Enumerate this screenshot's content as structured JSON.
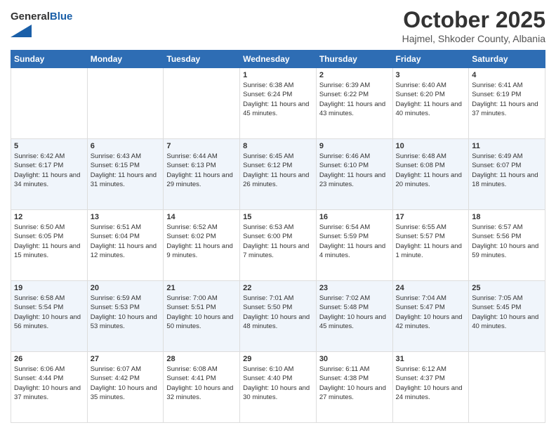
{
  "logo": {
    "general": "General",
    "blue": "Blue"
  },
  "header": {
    "month": "October 2025",
    "location": "Hajmel, Shkoder County, Albania"
  },
  "weekdays": [
    "Sunday",
    "Monday",
    "Tuesday",
    "Wednesday",
    "Thursday",
    "Friday",
    "Saturday"
  ],
  "weeks": [
    [
      {
        "day": "",
        "info": ""
      },
      {
        "day": "",
        "info": ""
      },
      {
        "day": "",
        "info": ""
      },
      {
        "day": "1",
        "info": "Sunrise: 6:38 AM\nSunset: 6:24 PM\nDaylight: 11 hours and 45 minutes."
      },
      {
        "day": "2",
        "info": "Sunrise: 6:39 AM\nSunset: 6:22 PM\nDaylight: 11 hours and 43 minutes."
      },
      {
        "day": "3",
        "info": "Sunrise: 6:40 AM\nSunset: 6:20 PM\nDaylight: 11 hours and 40 minutes."
      },
      {
        "day": "4",
        "info": "Sunrise: 6:41 AM\nSunset: 6:19 PM\nDaylight: 11 hours and 37 minutes."
      }
    ],
    [
      {
        "day": "5",
        "info": "Sunrise: 6:42 AM\nSunset: 6:17 PM\nDaylight: 11 hours and 34 minutes."
      },
      {
        "day": "6",
        "info": "Sunrise: 6:43 AM\nSunset: 6:15 PM\nDaylight: 11 hours and 31 minutes."
      },
      {
        "day": "7",
        "info": "Sunrise: 6:44 AM\nSunset: 6:13 PM\nDaylight: 11 hours and 29 minutes."
      },
      {
        "day": "8",
        "info": "Sunrise: 6:45 AM\nSunset: 6:12 PM\nDaylight: 11 hours and 26 minutes."
      },
      {
        "day": "9",
        "info": "Sunrise: 6:46 AM\nSunset: 6:10 PM\nDaylight: 11 hours and 23 minutes."
      },
      {
        "day": "10",
        "info": "Sunrise: 6:48 AM\nSunset: 6:08 PM\nDaylight: 11 hours and 20 minutes."
      },
      {
        "day": "11",
        "info": "Sunrise: 6:49 AM\nSunset: 6:07 PM\nDaylight: 11 hours and 18 minutes."
      }
    ],
    [
      {
        "day": "12",
        "info": "Sunrise: 6:50 AM\nSunset: 6:05 PM\nDaylight: 11 hours and 15 minutes."
      },
      {
        "day": "13",
        "info": "Sunrise: 6:51 AM\nSunset: 6:04 PM\nDaylight: 11 hours and 12 minutes."
      },
      {
        "day": "14",
        "info": "Sunrise: 6:52 AM\nSunset: 6:02 PM\nDaylight: 11 hours and 9 minutes."
      },
      {
        "day": "15",
        "info": "Sunrise: 6:53 AM\nSunset: 6:00 PM\nDaylight: 11 hours and 7 minutes."
      },
      {
        "day": "16",
        "info": "Sunrise: 6:54 AM\nSunset: 5:59 PM\nDaylight: 11 hours and 4 minutes."
      },
      {
        "day": "17",
        "info": "Sunrise: 6:55 AM\nSunset: 5:57 PM\nDaylight: 11 hours and 1 minute."
      },
      {
        "day": "18",
        "info": "Sunrise: 6:57 AM\nSunset: 5:56 PM\nDaylight: 10 hours and 59 minutes."
      }
    ],
    [
      {
        "day": "19",
        "info": "Sunrise: 6:58 AM\nSunset: 5:54 PM\nDaylight: 10 hours and 56 minutes."
      },
      {
        "day": "20",
        "info": "Sunrise: 6:59 AM\nSunset: 5:53 PM\nDaylight: 10 hours and 53 minutes."
      },
      {
        "day": "21",
        "info": "Sunrise: 7:00 AM\nSunset: 5:51 PM\nDaylight: 10 hours and 50 minutes."
      },
      {
        "day": "22",
        "info": "Sunrise: 7:01 AM\nSunset: 5:50 PM\nDaylight: 10 hours and 48 minutes."
      },
      {
        "day": "23",
        "info": "Sunrise: 7:02 AM\nSunset: 5:48 PM\nDaylight: 10 hours and 45 minutes."
      },
      {
        "day": "24",
        "info": "Sunrise: 7:04 AM\nSunset: 5:47 PM\nDaylight: 10 hours and 42 minutes."
      },
      {
        "day": "25",
        "info": "Sunrise: 7:05 AM\nSunset: 5:45 PM\nDaylight: 10 hours and 40 minutes."
      }
    ],
    [
      {
        "day": "26",
        "info": "Sunrise: 6:06 AM\nSunset: 4:44 PM\nDaylight: 10 hours and 37 minutes."
      },
      {
        "day": "27",
        "info": "Sunrise: 6:07 AM\nSunset: 4:42 PM\nDaylight: 10 hours and 35 minutes."
      },
      {
        "day": "28",
        "info": "Sunrise: 6:08 AM\nSunset: 4:41 PM\nDaylight: 10 hours and 32 minutes."
      },
      {
        "day": "29",
        "info": "Sunrise: 6:10 AM\nSunset: 4:40 PM\nDaylight: 10 hours and 30 minutes."
      },
      {
        "day": "30",
        "info": "Sunrise: 6:11 AM\nSunset: 4:38 PM\nDaylight: 10 hours and 27 minutes."
      },
      {
        "day": "31",
        "info": "Sunrise: 6:12 AM\nSunset: 4:37 PM\nDaylight: 10 hours and 24 minutes."
      },
      {
        "day": "",
        "info": ""
      }
    ]
  ]
}
